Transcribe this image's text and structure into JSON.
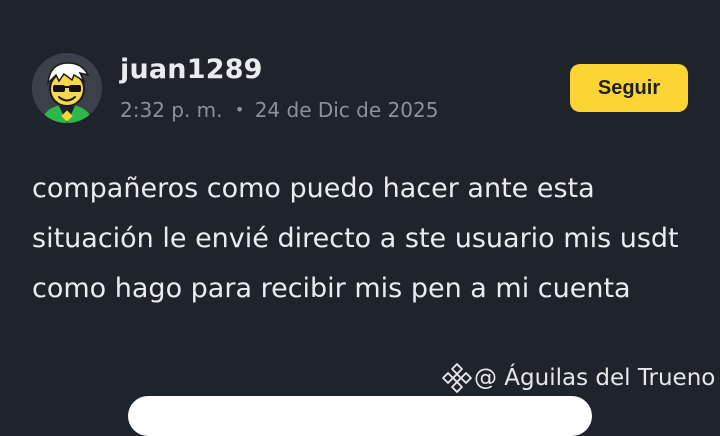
{
  "post": {
    "author": {
      "username": "juan1289",
      "avatar_icon": "sunglasses-smiley-avatar"
    },
    "time": "2:32 p. m.",
    "separator": "•",
    "date": "24 de Dic de 2025",
    "follow_label": "Seguir",
    "body": "compañeros como puedo hacer ante esta situación le envié directo a ste usuario mis usdt como hago para recibir mis pen a mi cuenta"
  },
  "watermark": {
    "icon": "binance-logo-icon",
    "handle": "@ Águilas del Trueno"
  },
  "colors": {
    "background": "#1f232b",
    "accent": "#fcd535",
    "text": "#eaecef",
    "muted": "#8b919b"
  }
}
